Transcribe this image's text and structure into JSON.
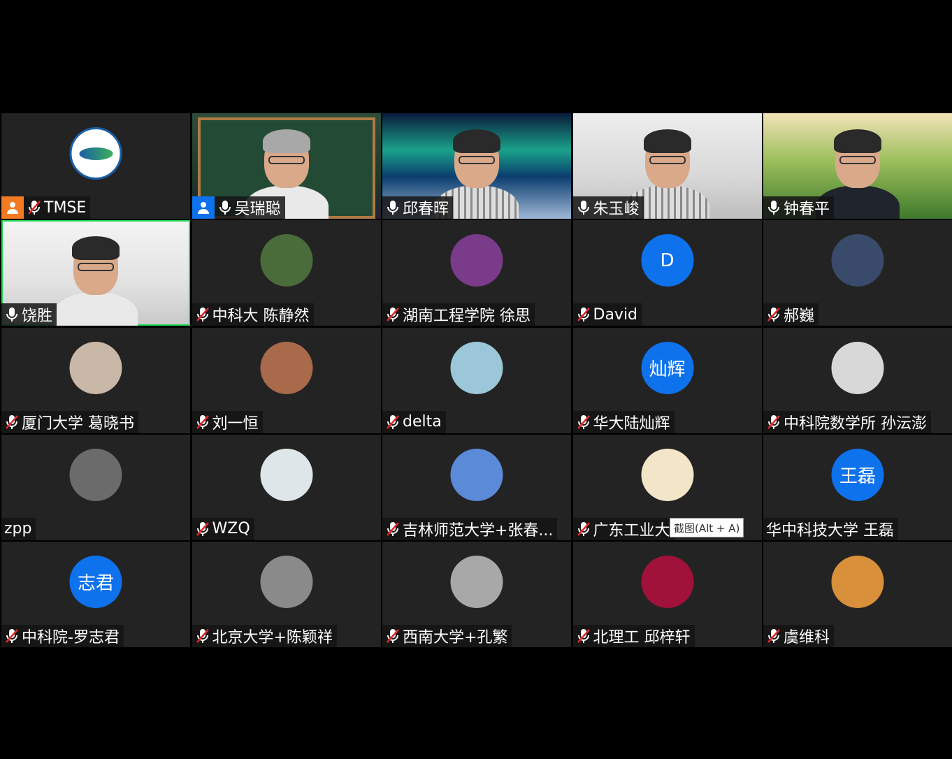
{
  "participants": [
    {
      "name": "TMSE",
      "muted": true,
      "badge": "orange",
      "video": "logo",
      "avatar_text": "",
      "avatar_color": ""
    },
    {
      "name": "吴瑞聪",
      "muted": false,
      "badge": "blue",
      "video": "v1",
      "avatar_text": "",
      "avatar_color": ""
    },
    {
      "name": "邱春晖",
      "muted": false,
      "badge": "",
      "video": "v2",
      "avatar_text": "",
      "avatar_color": ""
    },
    {
      "name": "朱玉峻",
      "muted": false,
      "badge": "",
      "video": "v3",
      "avatar_text": "",
      "avatar_color": ""
    },
    {
      "name": "钟春平",
      "muted": false,
      "badge": "",
      "video": "v4",
      "avatar_text": "",
      "avatar_color": ""
    },
    {
      "name": "饶胜",
      "muted": false,
      "badge": "",
      "video": "v5",
      "avatar_text": "",
      "avatar_color": "",
      "speaking": true
    },
    {
      "name": "中科大 陈静然",
      "muted": true,
      "badge": "",
      "video": "avatar",
      "avatar_text": "",
      "avatar_color": "#4a6b3a"
    },
    {
      "name": "湖南工程学院 徐思",
      "muted": true,
      "badge": "",
      "video": "avatar",
      "avatar_text": "",
      "avatar_color": "#7a3b8a"
    },
    {
      "name": "David",
      "muted": true,
      "badge": "",
      "video": "avatar",
      "avatar_text": "D",
      "avatar_color": "#0e72ed"
    },
    {
      "name": "郝巍",
      "muted": true,
      "badge": "",
      "video": "avatar",
      "avatar_text": "",
      "avatar_color": "#3a4a6a"
    },
    {
      "name": "厦门大学 葛晓书",
      "muted": true,
      "badge": "",
      "video": "avatar",
      "avatar_text": "",
      "avatar_color": "#c9b8a8"
    },
    {
      "name": "刘一恒",
      "muted": true,
      "badge": "",
      "video": "avatar",
      "avatar_text": "",
      "avatar_color": "#a86a4a"
    },
    {
      "name": "delta",
      "muted": true,
      "badge": "",
      "video": "avatar",
      "avatar_text": "",
      "avatar_color": "#9cc7d8"
    },
    {
      "name": "华大陆灿辉",
      "muted": true,
      "badge": "",
      "video": "avatar",
      "avatar_text": "灿辉",
      "avatar_color": "#0e72ed"
    },
    {
      "name": "中科院数学所 孙沄澎",
      "muted": true,
      "badge": "",
      "video": "avatar",
      "avatar_text": "",
      "avatar_color": "#d8d8d8"
    },
    {
      "name": "zpp",
      "muted": false,
      "no_mic": true,
      "badge": "",
      "video": "avatar",
      "avatar_text": "",
      "avatar_color": "#6b6b6b"
    },
    {
      "name": "WZQ",
      "muted": true,
      "badge": "",
      "video": "avatar",
      "avatar_text": "",
      "avatar_color": "#dfe6ea"
    },
    {
      "name": "吉林师范大学+张春...",
      "muted": true,
      "badge": "",
      "video": "avatar",
      "avatar_text": "",
      "avatar_color": "#5a8ad8"
    },
    {
      "name": "广东工业大",
      "muted": true,
      "badge": "",
      "video": "avatar",
      "avatar_text": "",
      "avatar_color": "#f3e6c8"
    },
    {
      "name": "华中科技大学 王磊",
      "muted": false,
      "no_mic": true,
      "badge": "",
      "video": "avatar",
      "avatar_text": "王磊",
      "avatar_color": "#0e72ed"
    },
    {
      "name": "中科院-罗志君",
      "muted": true,
      "badge": "",
      "video": "avatar",
      "avatar_text": "志君",
      "avatar_color": "#0e72ed"
    },
    {
      "name": "北京大学+陈颖祥",
      "muted": true,
      "badge": "",
      "video": "avatar",
      "avatar_text": "",
      "avatar_color": "#8a8a8a"
    },
    {
      "name": "西南大学+孔繁",
      "muted": true,
      "badge": "",
      "video": "avatar",
      "avatar_text": "",
      "avatar_color": "#a8a8a8"
    },
    {
      "name": "北理工 邱梓轩",
      "muted": true,
      "badge": "",
      "video": "avatar",
      "avatar_text": "",
      "avatar_color": "#a0123a"
    },
    {
      "name": "虞维科",
      "muted": true,
      "badge": "",
      "video": "avatar",
      "avatar_text": "",
      "avatar_color": "#d8903a"
    }
  ],
  "tooltip": "截图(Alt + A)",
  "colors": {
    "accent": "#0e72ed",
    "host": "#f37a22",
    "speaking": "#23d959",
    "muted": "#e02828"
  }
}
